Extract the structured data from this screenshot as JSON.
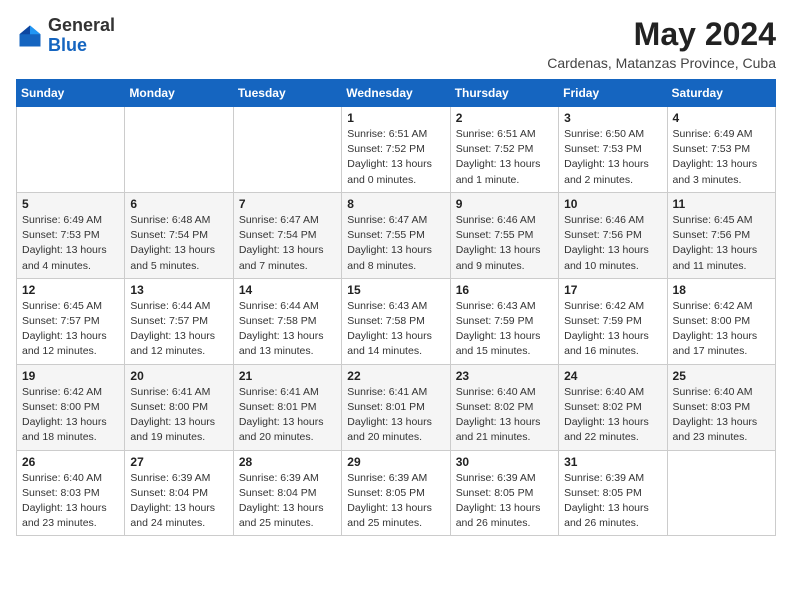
{
  "header": {
    "logo_general": "General",
    "logo_blue": "Blue",
    "month_year": "May 2024",
    "location": "Cardenas, Matanzas Province, Cuba"
  },
  "days_of_week": [
    "Sunday",
    "Monday",
    "Tuesday",
    "Wednesday",
    "Thursday",
    "Friday",
    "Saturday"
  ],
  "weeks": [
    [
      {
        "day": "",
        "info": ""
      },
      {
        "day": "",
        "info": ""
      },
      {
        "day": "",
        "info": ""
      },
      {
        "day": "1",
        "info": "Sunrise: 6:51 AM\nSunset: 7:52 PM\nDaylight: 13 hours\nand 0 minutes."
      },
      {
        "day": "2",
        "info": "Sunrise: 6:51 AM\nSunset: 7:52 PM\nDaylight: 13 hours\nand 1 minute."
      },
      {
        "day": "3",
        "info": "Sunrise: 6:50 AM\nSunset: 7:53 PM\nDaylight: 13 hours\nand 2 minutes."
      },
      {
        "day": "4",
        "info": "Sunrise: 6:49 AM\nSunset: 7:53 PM\nDaylight: 13 hours\nand 3 minutes."
      }
    ],
    [
      {
        "day": "5",
        "info": "Sunrise: 6:49 AM\nSunset: 7:53 PM\nDaylight: 13 hours\nand 4 minutes."
      },
      {
        "day": "6",
        "info": "Sunrise: 6:48 AM\nSunset: 7:54 PM\nDaylight: 13 hours\nand 5 minutes."
      },
      {
        "day": "7",
        "info": "Sunrise: 6:47 AM\nSunset: 7:54 PM\nDaylight: 13 hours\nand 7 minutes."
      },
      {
        "day": "8",
        "info": "Sunrise: 6:47 AM\nSunset: 7:55 PM\nDaylight: 13 hours\nand 8 minutes."
      },
      {
        "day": "9",
        "info": "Sunrise: 6:46 AM\nSunset: 7:55 PM\nDaylight: 13 hours\nand 9 minutes."
      },
      {
        "day": "10",
        "info": "Sunrise: 6:46 AM\nSunset: 7:56 PM\nDaylight: 13 hours\nand 10 minutes."
      },
      {
        "day": "11",
        "info": "Sunrise: 6:45 AM\nSunset: 7:56 PM\nDaylight: 13 hours\nand 11 minutes."
      }
    ],
    [
      {
        "day": "12",
        "info": "Sunrise: 6:45 AM\nSunset: 7:57 PM\nDaylight: 13 hours\nand 12 minutes."
      },
      {
        "day": "13",
        "info": "Sunrise: 6:44 AM\nSunset: 7:57 PM\nDaylight: 13 hours\nand 12 minutes."
      },
      {
        "day": "14",
        "info": "Sunrise: 6:44 AM\nSunset: 7:58 PM\nDaylight: 13 hours\nand 13 minutes."
      },
      {
        "day": "15",
        "info": "Sunrise: 6:43 AM\nSunset: 7:58 PM\nDaylight: 13 hours\nand 14 minutes."
      },
      {
        "day": "16",
        "info": "Sunrise: 6:43 AM\nSunset: 7:59 PM\nDaylight: 13 hours\nand 15 minutes."
      },
      {
        "day": "17",
        "info": "Sunrise: 6:42 AM\nSunset: 7:59 PM\nDaylight: 13 hours\nand 16 minutes."
      },
      {
        "day": "18",
        "info": "Sunrise: 6:42 AM\nSunset: 8:00 PM\nDaylight: 13 hours\nand 17 minutes."
      }
    ],
    [
      {
        "day": "19",
        "info": "Sunrise: 6:42 AM\nSunset: 8:00 PM\nDaylight: 13 hours\nand 18 minutes."
      },
      {
        "day": "20",
        "info": "Sunrise: 6:41 AM\nSunset: 8:00 PM\nDaylight: 13 hours\nand 19 minutes."
      },
      {
        "day": "21",
        "info": "Sunrise: 6:41 AM\nSunset: 8:01 PM\nDaylight: 13 hours\nand 20 minutes."
      },
      {
        "day": "22",
        "info": "Sunrise: 6:41 AM\nSunset: 8:01 PM\nDaylight: 13 hours\nand 20 minutes."
      },
      {
        "day": "23",
        "info": "Sunrise: 6:40 AM\nSunset: 8:02 PM\nDaylight: 13 hours\nand 21 minutes."
      },
      {
        "day": "24",
        "info": "Sunrise: 6:40 AM\nSunset: 8:02 PM\nDaylight: 13 hours\nand 22 minutes."
      },
      {
        "day": "25",
        "info": "Sunrise: 6:40 AM\nSunset: 8:03 PM\nDaylight: 13 hours\nand 23 minutes."
      }
    ],
    [
      {
        "day": "26",
        "info": "Sunrise: 6:40 AM\nSunset: 8:03 PM\nDaylight: 13 hours\nand 23 minutes."
      },
      {
        "day": "27",
        "info": "Sunrise: 6:39 AM\nSunset: 8:04 PM\nDaylight: 13 hours\nand 24 minutes."
      },
      {
        "day": "28",
        "info": "Sunrise: 6:39 AM\nSunset: 8:04 PM\nDaylight: 13 hours\nand 25 minutes."
      },
      {
        "day": "29",
        "info": "Sunrise: 6:39 AM\nSunset: 8:05 PM\nDaylight: 13 hours\nand 25 minutes."
      },
      {
        "day": "30",
        "info": "Sunrise: 6:39 AM\nSunset: 8:05 PM\nDaylight: 13 hours\nand 26 minutes."
      },
      {
        "day": "31",
        "info": "Sunrise: 6:39 AM\nSunset: 8:05 PM\nDaylight: 13 hours\nand 26 minutes."
      },
      {
        "day": "",
        "info": ""
      }
    ]
  ]
}
